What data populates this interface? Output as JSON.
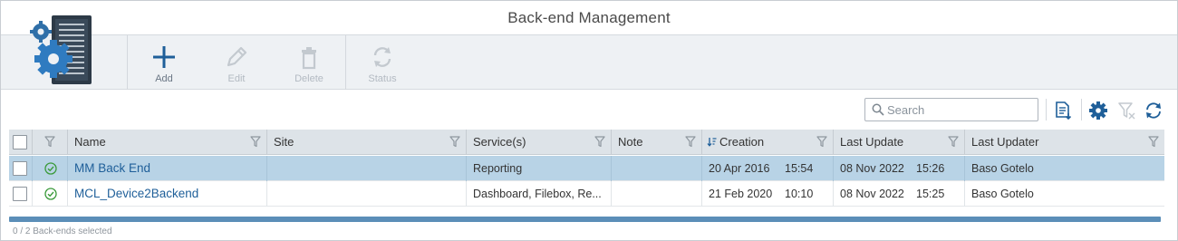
{
  "window": {
    "title": "Back-end Management"
  },
  "ribbon": {
    "logo_icon": "server-gear-icon",
    "buttons": [
      {
        "id": "add",
        "label": "Add",
        "icon": "plus-icon",
        "enabled": true
      },
      {
        "id": "edit",
        "label": "Edit",
        "icon": "pencil-icon",
        "enabled": false
      },
      {
        "id": "delete",
        "label": "Delete",
        "icon": "trash-icon",
        "enabled": false
      },
      {
        "id": "status",
        "label": "Status",
        "icon": "cycle-icon",
        "enabled": false
      }
    ]
  },
  "toolbar": {
    "search_placeholder": "Search",
    "search_value": "",
    "icons": [
      "export-list-icon",
      "gear-icon",
      "clear-filter-icon",
      "refresh-icon"
    ]
  },
  "grid": {
    "columns": [
      {
        "key": "select",
        "label": ""
      },
      {
        "key": "status",
        "label": ""
      },
      {
        "key": "name",
        "label": "Name"
      },
      {
        "key": "site",
        "label": "Site"
      },
      {
        "key": "services",
        "label": "Service(s)"
      },
      {
        "key": "note",
        "label": "Note"
      },
      {
        "key": "creation",
        "label": "Creation",
        "sorted": "descending"
      },
      {
        "key": "last_update",
        "label": "Last Update"
      },
      {
        "key": "last_updater",
        "label": "Last Updater"
      }
    ],
    "rows": [
      {
        "selected": true,
        "status": "ok",
        "name": "MM Back End",
        "site": "",
        "services": "Reporting",
        "note": "",
        "creation_date": "20 Apr 2016",
        "creation_time": "15:54",
        "last_update_date": "08 Nov 2022",
        "last_update_time": "15:26",
        "last_updater": "Baso Gotelo"
      },
      {
        "selected": false,
        "status": "ok",
        "name": "MCL_Device2Backend",
        "site": "",
        "services": "Dashboard, Filebox, Re...",
        "note": "",
        "creation_date": "21 Feb 2020",
        "creation_time": "10:10",
        "last_update_date": "08 Nov 2022",
        "last_update_time": "15:25",
        "last_updater": "Baso Gotelo"
      }
    ]
  },
  "footer": {
    "selection_text": "0 / 2 Back-ends selected"
  },
  "colors": {
    "accent": "#1f5f99",
    "row_selected": "#b8d3e6",
    "header_bg": "#dde3e8",
    "ribbon_bg": "#eef1f4",
    "status_ok": "#3a9a3a",
    "scrollbar": "#5b8eb8"
  }
}
